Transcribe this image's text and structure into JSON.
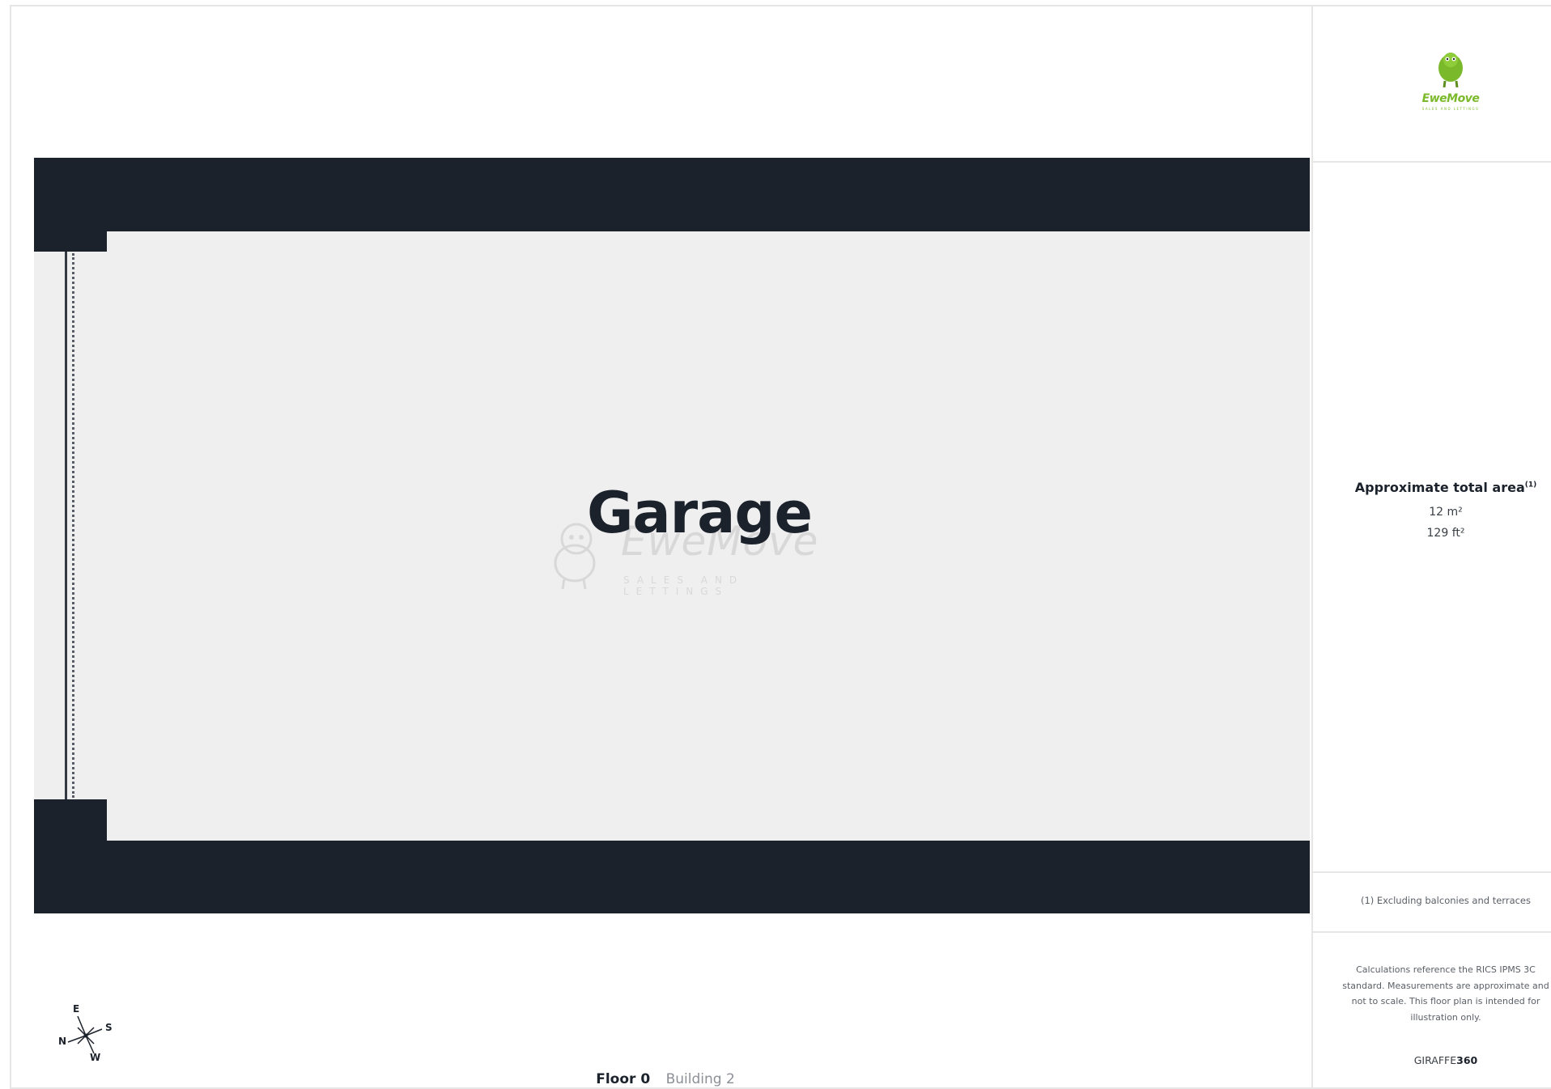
{
  "plan": {
    "room_label": "Garage",
    "watermark": {
      "word": "EweMove",
      "tagline": "SALES AND LETTINGS"
    },
    "compass": {
      "north": "N",
      "east": "E",
      "south": "S",
      "west": "W"
    },
    "floor_label": "Floor 0",
    "building_label": "Building 2"
  },
  "panel": {
    "logo": {
      "word": "EweMove",
      "tagline": "SALES AND LETTINGS"
    },
    "area_title": "Approximate total area",
    "area_title_note": "(1)",
    "area_m2": "12 m²",
    "area_ft2": "129 ft²",
    "footnote": "(1) Excluding balconies and terraces",
    "disclaimer": "Calculations reference the RICS IPMS 3C standard. Measurements are approximate and not to scale. This floor plan is intended for illustration only.",
    "brand_prefix": "GIRAFFE",
    "brand_suffix": "360"
  },
  "colors": {
    "wall": "#1c222b",
    "floor": "#efefef",
    "brand_green": "#7ab929"
  }
}
